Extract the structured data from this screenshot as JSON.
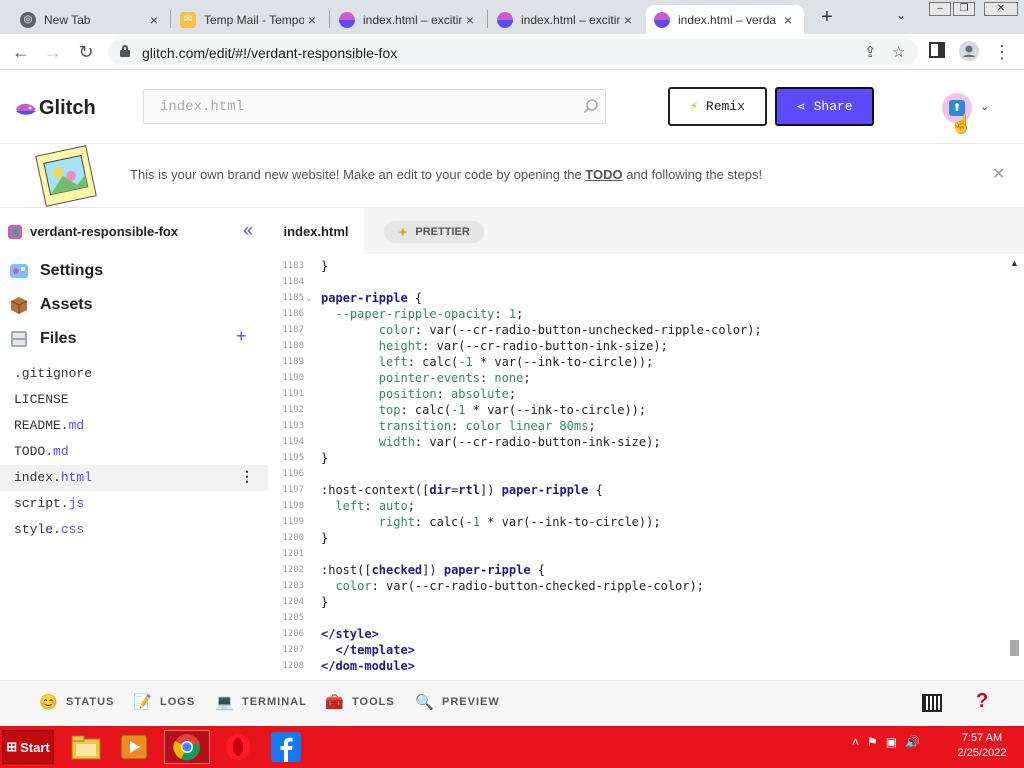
{
  "browser": {
    "tabs": [
      {
        "title": "New Tab",
        "icon": "chrome-icon",
        "active": false
      },
      {
        "title": "Temp Mail - Tempo",
        "icon": "temp-mail-icon",
        "active": false
      },
      {
        "title": "index.html – excitin",
        "icon": "glitch-icon",
        "active": false
      },
      {
        "title": "index.html – excitin",
        "icon": "glitch-icon",
        "active": false
      },
      {
        "title": "index.html – verda",
        "icon": "glitch-icon",
        "active": true
      }
    ],
    "url": "glitch.com/edit/#!/verdant-responsible-fox",
    "window_controls": {
      "minimize": "–",
      "restore": "❐",
      "close": "✕"
    }
  },
  "header": {
    "logo": "Glitch",
    "search_placeholder": "index.html",
    "remix_label": "Remix",
    "share_label": "Share"
  },
  "banner": {
    "text_before": "This is your own brand new website! Make an edit to your code by opening the ",
    "link": "TODO",
    "text_after": " and following the steps!"
  },
  "sidebar": {
    "project_name": "verdant-responsible-fox",
    "sections": [
      "Settings",
      "Assets",
      "Files"
    ],
    "files": [
      {
        "base": ".gitignore",
        "ext": ""
      },
      {
        "base": "LICENSE",
        "ext": ""
      },
      {
        "base": "README.",
        "ext": "md"
      },
      {
        "base": "TODO.",
        "ext": "md"
      },
      {
        "base": "index.",
        "ext": "html",
        "selected": true
      },
      {
        "base": "script.",
        "ext": "js"
      },
      {
        "base": "style.",
        "ext": "css"
      }
    ]
  },
  "editor": {
    "tab": "index.html",
    "prettier_label": "PRETTIER",
    "lines": [
      {
        "n": "1183",
        "html": "}"
      },
      {
        "n": "1184",
        "html": ""
      },
      {
        "n": "1185",
        "fold": true,
        "html": "<span class='k'>paper-ripple</span> {"
      },
      {
        "n": "1186",
        "html": "  <span class='p'>--paper-ripple-opacity</span>: <span class='n'>1</span>;"
      },
      {
        "n": "1187",
        "html": "        <span class='p'>color</span>: var(--cr-radio-button-unchecked-ripple-color);"
      },
      {
        "n": "1188",
        "html": "        <span class='p'>height</span>: var(--cr-radio-button-ink-size);"
      },
      {
        "n": "1189",
        "html": "        <span class='p'>left</span>: calc(<span class='n'>-1</span> * var(--ink-to-circle));"
      },
      {
        "n": "1190",
        "html": "        <span class='p'>pointer-events</span>: <span class='n'>none</span>;"
      },
      {
        "n": "1191",
        "html": "        <span class='p'>position</span>: <span class='n'>absolute</span>;"
      },
      {
        "n": "1192",
        "html": "        <span class='p'>top</span>: calc(<span class='n'>-1</span> * var(--ink-to-circle));"
      },
      {
        "n": "1193",
        "html": "        <span class='p'>transition</span>: <span class='n'>color linear 80ms</span>;"
      },
      {
        "n": "1194",
        "html": "        <span class='p'>width</span>: var(--cr-radio-button-ink-size);"
      },
      {
        "n": "1195",
        "html": "}"
      },
      {
        "n": "1196",
        "html": ""
      },
      {
        "n": "1197",
        "html": ":host-context([<span class='k'>dir</span>=<span class='k'>rtl</span>]) <span class='k'>paper-ripple</span> {"
      },
      {
        "n": "1198",
        "html": "  <span class='p'>left</span>: <span class='n'>auto</span>;"
      },
      {
        "n": "1199",
        "html": "        <span class='p'>right</span>: calc(<span class='n'>-1</span> * var(--ink-to-circle));"
      },
      {
        "n": "1200",
        "html": "}"
      },
      {
        "n": "1201",
        "html": ""
      },
      {
        "n": "1202",
        "html": ":host([<span class='k'>checked</span>]) <span class='k'>paper-ripple</span> {"
      },
      {
        "n": "1203",
        "html": "  <span class='p'>color</span>: var(--cr-radio-button-checked-ripple-color);"
      },
      {
        "n": "1204",
        "html": "}"
      },
      {
        "n": "1205",
        "html": ""
      },
      {
        "n": "1206",
        "html": "<span class='k'>&lt;/style&gt;</span>"
      },
      {
        "n": "1207",
        "html": "  <span class='k'>&lt;/template&gt;</span>"
      },
      {
        "n": "1208",
        "html": "<span class='k'>&lt;/dom-module&gt;</span>"
      }
    ]
  },
  "statusbar": [
    {
      "label": "STATUS",
      "icon": "smiley-icon"
    },
    {
      "label": "LOGS",
      "icon": "notepad-icon"
    },
    {
      "label": "TERMINAL",
      "icon": "laptop-icon"
    },
    {
      "label": "TOOLS",
      "icon": "toolbox-icon"
    },
    {
      "label": "PREVIEW",
      "icon": "magnifier-icon"
    }
  ],
  "help_label": "?",
  "taskbar": {
    "start_label": "Start",
    "apps": [
      "file-explorer-icon",
      "media-player-icon",
      "chrome-icon",
      "opera-icon",
      "facebook-icon"
    ],
    "time": "7:57 AM",
    "date": "2/25/2022"
  }
}
